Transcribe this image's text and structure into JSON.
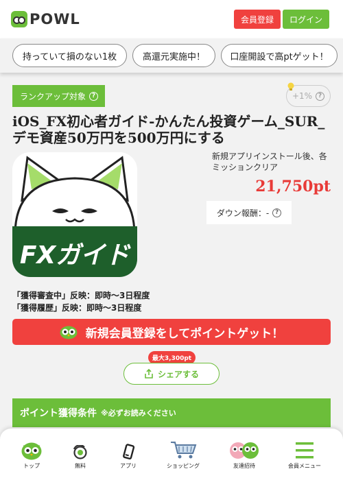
{
  "header": {
    "logo_text": "POWL",
    "register_label": "会員登録",
    "login_label": "ログイン"
  },
  "chips": [
    {
      "label": "持っていて損のない1枚"
    },
    {
      "label": "高還元実施中！"
    },
    {
      "label": "口座開設で高ptゲット！"
    }
  ],
  "offer": {
    "rank_badge": "ランクアップ対象",
    "bonus_label": "+1%",
    "title": "iOS_FX初心者ガイド-かんたん投資ゲーム_SUR_デモ資産50万円を500万円にする",
    "icon_text": "FXガイド",
    "mission": "新規アプリインストール後、各ミッションクリア",
    "points": "21,750pt",
    "down_reward": "ダウン報酬：-",
    "review_line_1": "「獲得審査中」反映：即時～3日程度",
    "review_line_2": "「獲得履歴」反映：即時～3日程度"
  },
  "cta": {
    "register_label": "新規会員登録をしてポイントゲット！"
  },
  "share": {
    "tag": "最大3,300pt",
    "label": "シェアする"
  },
  "conditions": {
    "title": "ポイント獲得条件",
    "note": "※必ずお読みください"
  },
  "bottom_nav": [
    {
      "label": "トップ",
      "icon": "owl-icon"
    },
    {
      "label": "無料",
      "icon": "coin-icon"
    },
    {
      "label": "アプリ",
      "icon": "smartphone-icon"
    },
    {
      "label": "ショッピング",
      "icon": "cart-icon"
    },
    {
      "label": "友達招待",
      "icon": "friends-icon"
    },
    {
      "label": "会員メニュー",
      "icon": "menu-icon"
    }
  ],
  "colors": {
    "brand_green": "#6cbe3a",
    "accent_red": "#f0413e",
    "points_red": "#e83b38",
    "icon_dark_green": "#1e5f2b"
  }
}
